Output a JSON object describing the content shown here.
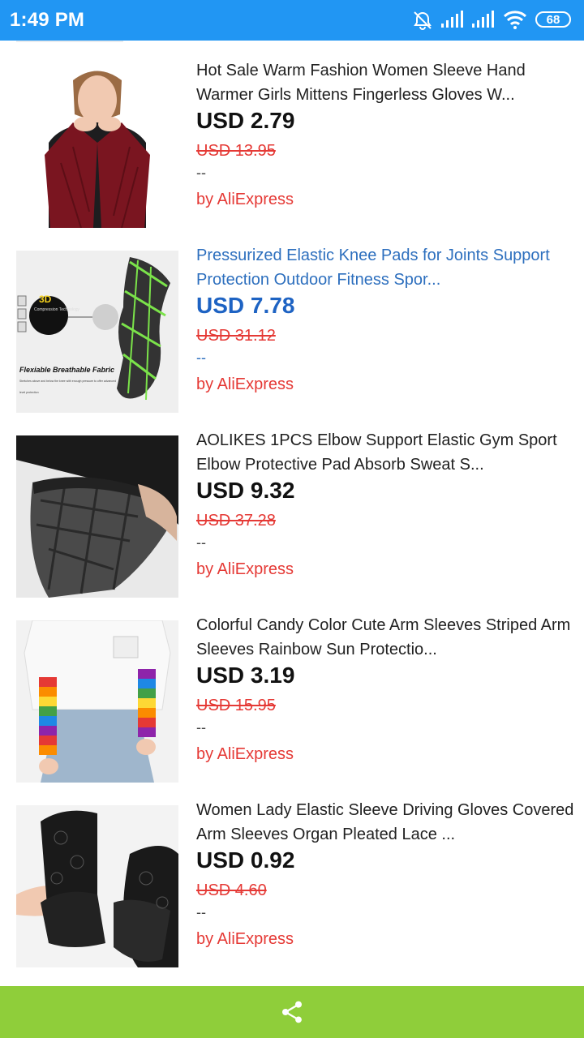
{
  "status_bar": {
    "time": "1:49 PM",
    "battery": "68",
    "icons": [
      "alarm-off-icon",
      "signal-icon",
      "signal-icon",
      "wifi-icon",
      "battery-icon"
    ]
  },
  "products": [
    {
      "title": "Hot Sale Warm Fashion Women Sleeve Hand Warmer Girls Mittens Fingerless Gloves W...",
      "price": "USD 2.79",
      "original_price": "USD 13.95",
      "extra": "--",
      "seller": "by AliExpress"
    },
    {
      "title": "Pressurized Elastic Knee Pads for Joints Support Protection Outdoor Fitness Spor...",
      "price": "USD 7.78",
      "original_price": "USD 31.12",
      "extra": "--",
      "seller": "by AliExpress",
      "thumb_text": {
        "badge": "3D",
        "tech": "Compression Technology",
        "caption": "Flexiable Breathable Fabric",
        "sub1": "Stretches above and below the knee with enough pressure to offer advanced",
        "sub2": "level protection"
      }
    },
    {
      "title": "AOLIKES 1PCS Elbow Support Elastic Gym Sport Elbow Protective Pad Absorb Sweat S...",
      "price": "USD 9.32",
      "original_price": "USD 37.28",
      "extra": "--",
      "seller": "by AliExpress"
    },
    {
      "title": "Colorful Candy Color Cute Arm Sleeves Striped Arm Sleeves Rainbow Sun Protectio...",
      "price": "USD 3.19",
      "original_price": "USD 15.95",
      "extra": "--",
      "seller": "by AliExpress"
    },
    {
      "title": "Women Lady Elastic Sleeve Driving Gloves Covered Arm Sleeves Organ Pleated Lace ...",
      "price": "USD 0.92",
      "original_price": "USD 4.60",
      "extra": "--",
      "seller": "by AliExpress"
    }
  ],
  "bottom_bar": {
    "share_icon": "share-icon"
  },
  "colors": {
    "status_bar": "#2196f3",
    "bottom_bar": "#8fce3a",
    "accent_blue": "#1e63c3",
    "sale_red": "#e53935"
  }
}
